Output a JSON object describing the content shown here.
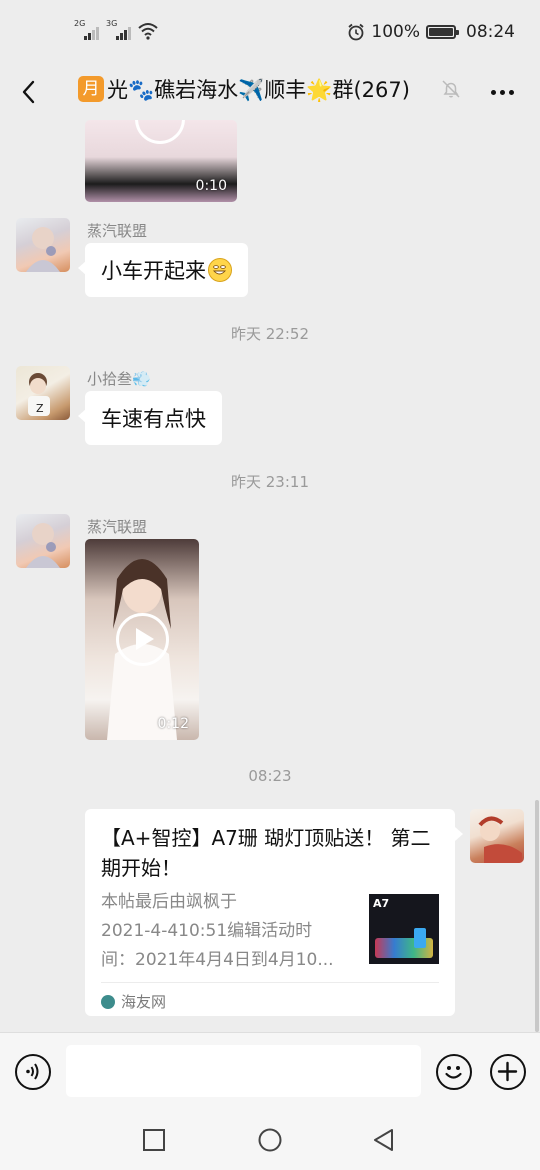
{
  "status_bar": {
    "sim1": "2G",
    "sim2": "3G",
    "battery": "100%",
    "time": "08:24"
  },
  "header": {
    "title_badge": "月",
    "title_text": "光🐾礁岩海水✈️顺丰🌟群(267)"
  },
  "messages": [
    {
      "type": "video",
      "duration": "0:10"
    },
    {
      "sender": "蒸汽联盟",
      "text": "小车开起来"
    },
    {
      "type": "time",
      "text": "昨天 22:52"
    },
    {
      "sender": "小拾叁💨",
      "text": "车速有点快"
    },
    {
      "type": "time",
      "text": "昨天 23:11"
    },
    {
      "sender": "蒸汽联盟",
      "type": "video",
      "duration": "0:12"
    },
    {
      "type": "time",
      "text": "08:23"
    }
  ],
  "link_card": {
    "title": "【A+智控】A7珊 瑚灯顶贴送！ 第二期开始！",
    "desc_lines": [
      "本帖最后由飒枫于",
      "2021-4-410:51编辑活动时",
      "间：2021年4月4日到4月10..."
    ],
    "thumb_label": "A7",
    "source": "海友网"
  },
  "input": {
    "value": ""
  },
  "colors": {
    "chat_bg": "#ededed",
    "bubble": "#ffffff",
    "badge_orange": "#f39a2b",
    "meta_gray": "#888888"
  }
}
